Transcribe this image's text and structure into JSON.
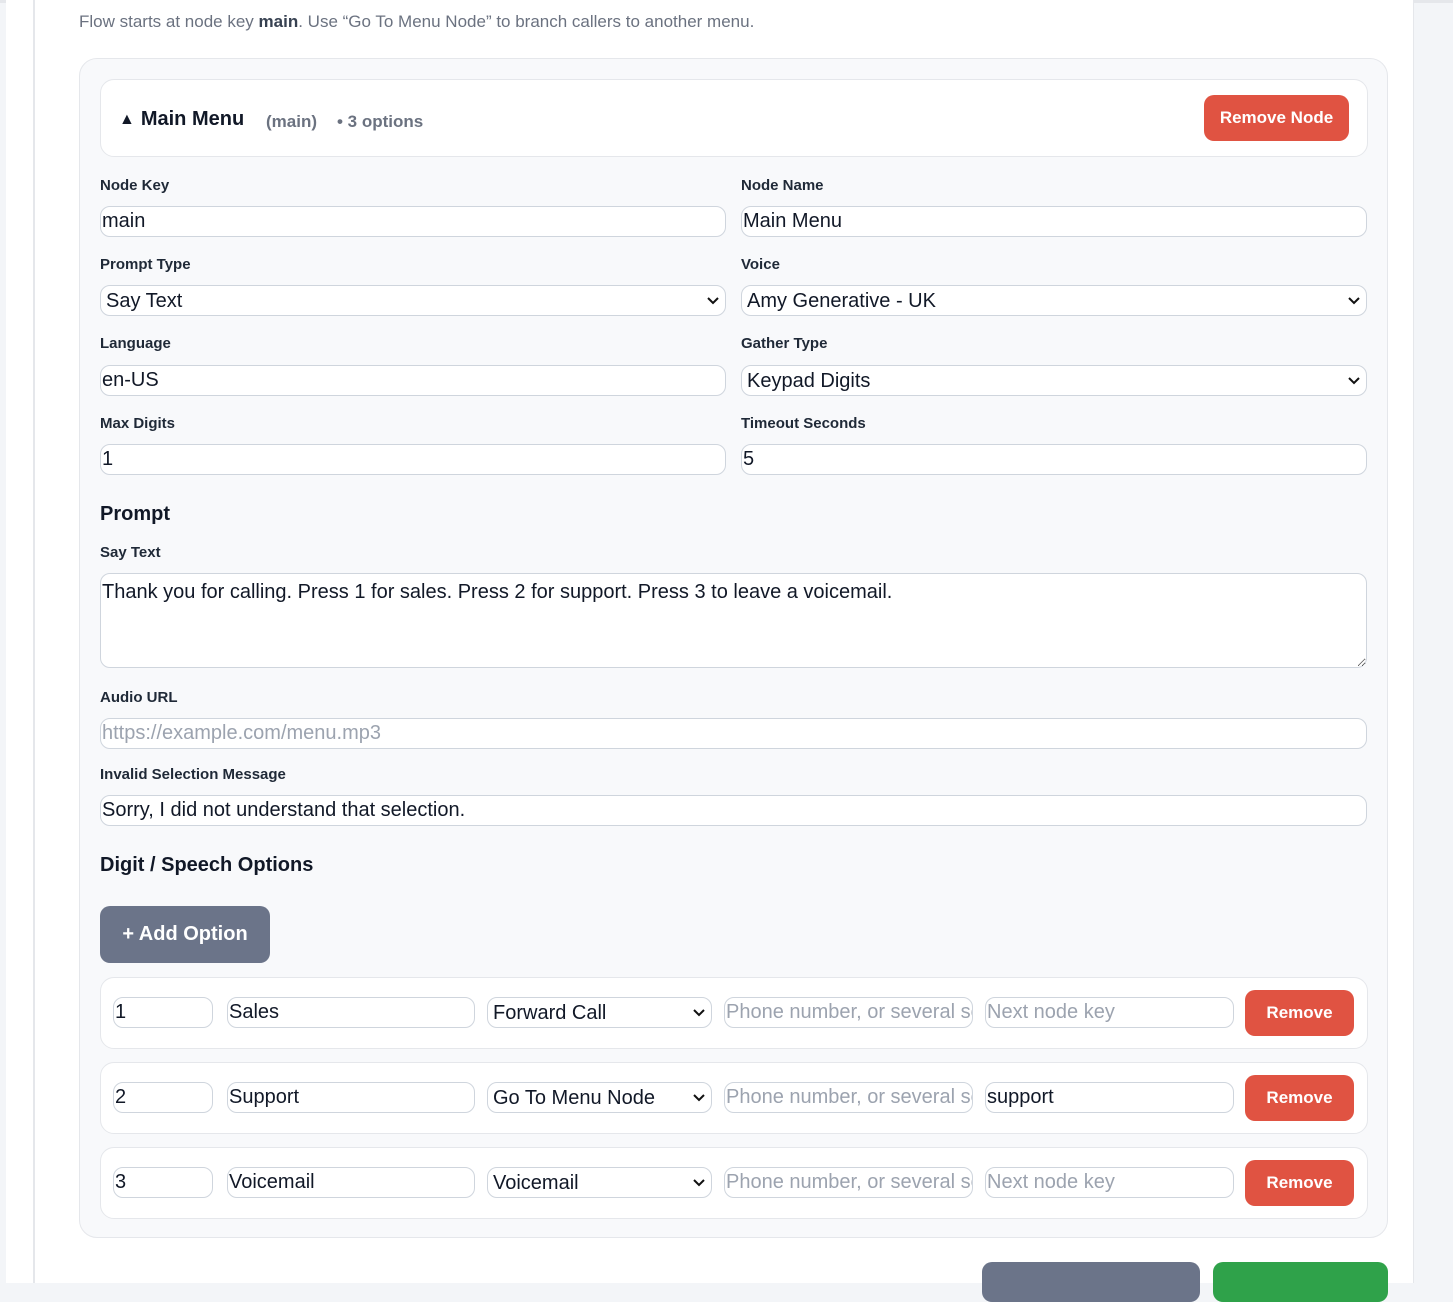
{
  "intro": {
    "prefix": "Flow starts at node key ",
    "key": "main",
    "suffix": ". Use “Go To Menu Node” to branch callers to another menu."
  },
  "node": {
    "caret_icon": "triangle-up-icon",
    "title": "Main Menu",
    "key_display": "(main)",
    "option_count": "• 3 options",
    "remove_node_label": "Remove Node"
  },
  "fields": {
    "node_key": {
      "label": "Node Key",
      "value": "main"
    },
    "node_name": {
      "label": "Node Name",
      "value": "Main Menu"
    },
    "prompt_type": {
      "label": "Prompt Type",
      "value": "Say Text"
    },
    "voice": {
      "label": "Voice",
      "value": "Amy Generative - UK"
    },
    "language": {
      "label": "Language",
      "value": "en-US"
    },
    "gather_type": {
      "label": "Gather Type",
      "value": "Keypad Digits"
    },
    "max_digits": {
      "label": "Max Digits",
      "value": "1"
    },
    "timeout_seconds": {
      "label": "Timeout Seconds",
      "value": "5"
    }
  },
  "prompt": {
    "heading": "Prompt",
    "say_text_label": "Say Text",
    "say_text_value": "Thank you for calling. Press 1 for sales. Press 2 for support. Press 3 to leave a voicemail.",
    "audio_url_label": "Audio URL",
    "audio_url_placeholder": "https://example.com/menu.mp3",
    "invalid_label": "Invalid Selection Message",
    "invalid_value": "Sorry, I did not understand that selection."
  },
  "options": {
    "heading": "Digit / Speech Options",
    "add_label": "+ Add Option",
    "phone_placeholder": "Phone number, or several separated by commas",
    "next_placeholder": "Next node key",
    "remove_label": "Remove",
    "rows": [
      {
        "digit": "1",
        "label": "Sales",
        "action": "Forward Call",
        "next": ""
      },
      {
        "digit": "2",
        "label": "Support",
        "action": "Go To Menu Node",
        "next": "support"
      },
      {
        "digit": "3",
        "label": "Voicemail",
        "action": "Voicemail",
        "next": ""
      }
    ]
  },
  "colors": {
    "danger": "#e05342",
    "secondary": "#6b7489",
    "success": "#2fa24a"
  }
}
